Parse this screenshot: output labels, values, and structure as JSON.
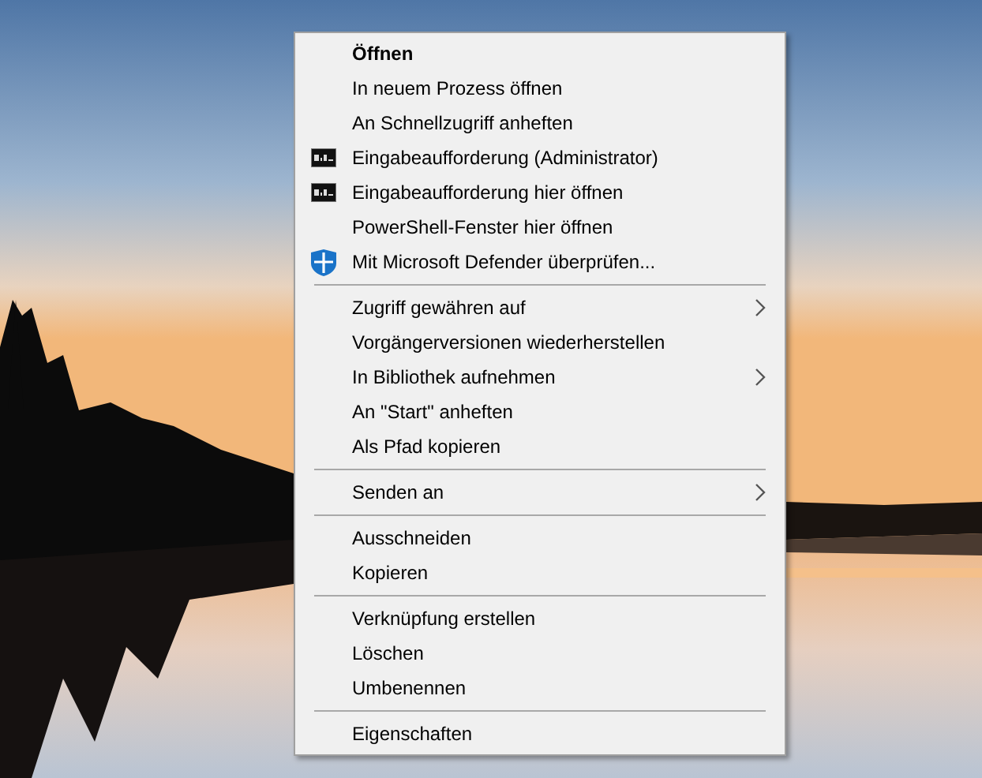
{
  "context_menu": {
    "groups": [
      {
        "items": [
          {
            "label": "Öffnen",
            "kind": "default"
          },
          {
            "label": "In neuem Prozess öffnen",
            "kind": "plain"
          },
          {
            "label": "An Schnellzugriff anheften",
            "kind": "plain"
          },
          {
            "label": "Eingabeaufforderung (Administrator)",
            "kind": "console"
          },
          {
            "label": "Eingabeaufforderung hier öffnen",
            "kind": "console"
          },
          {
            "label": "PowerShell-Fenster hier öffnen",
            "kind": "plain"
          },
          {
            "label": "Mit Microsoft Defender überprüfen...",
            "kind": "shield"
          }
        ]
      },
      {
        "items": [
          {
            "label": "Zugriff gewähren auf",
            "kind": "submenu"
          },
          {
            "label": "Vorgängerversionen wiederherstellen",
            "kind": "plain"
          },
          {
            "label": "In Bibliothek aufnehmen",
            "kind": "submenu"
          },
          {
            "label": "An \"Start\" anheften",
            "kind": "plain"
          },
          {
            "label": "Als Pfad kopieren",
            "kind": "plain"
          }
        ]
      },
      {
        "items": [
          {
            "label": "Senden an",
            "kind": "submenu"
          }
        ]
      },
      {
        "items": [
          {
            "label": "Ausschneiden",
            "kind": "plain"
          },
          {
            "label": "Kopieren",
            "kind": "plain"
          }
        ]
      },
      {
        "items": [
          {
            "label": "Verknüpfung erstellen",
            "kind": "plain"
          },
          {
            "label": "Löschen",
            "kind": "plain"
          },
          {
            "label": "Umbenennen",
            "kind": "plain"
          }
        ]
      },
      {
        "items": [
          {
            "label": "Eigenschaften",
            "kind": "plain"
          }
        ]
      }
    ]
  }
}
